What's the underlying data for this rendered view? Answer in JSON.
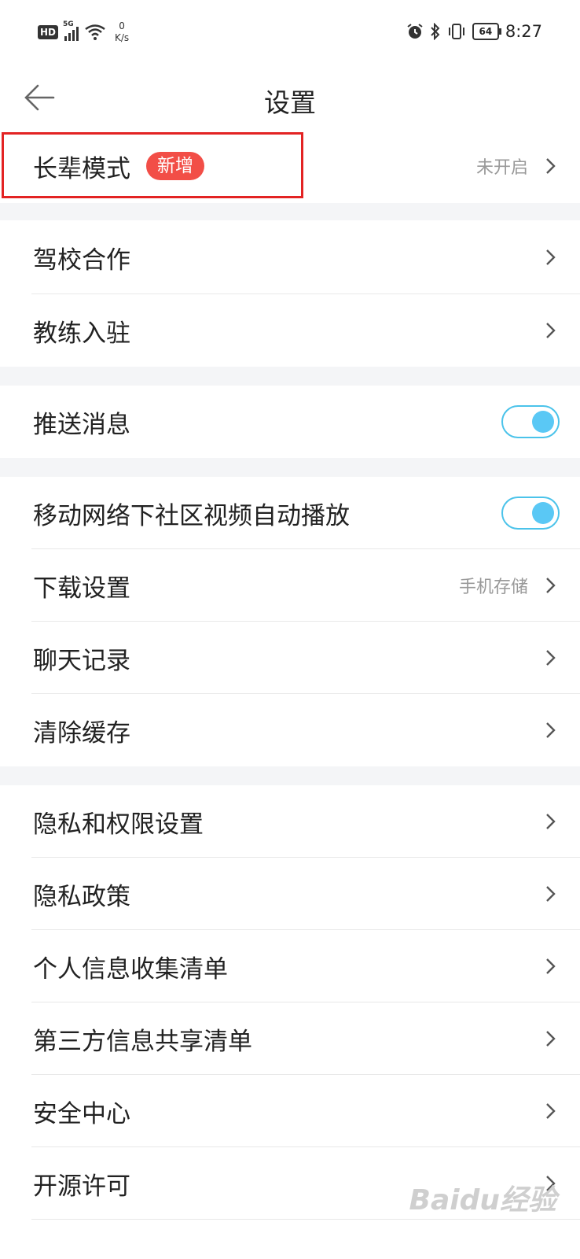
{
  "status_bar": {
    "hd": "HD",
    "network": "5G",
    "speed_value": "0",
    "speed_unit": "K/s",
    "battery": "64",
    "time": "8:27",
    "icons": [
      "hd-icon",
      "signal-icon",
      "wifi-icon",
      "alarm-icon",
      "bluetooth-icon",
      "vibrate-icon",
      "battery-icon"
    ]
  },
  "header": {
    "title": "设置",
    "back_icon": "back-arrow-icon"
  },
  "settings": {
    "elder_mode": {
      "label": "长辈模式",
      "badge": "新增",
      "value": "未开启"
    },
    "driving_school": {
      "label": "驾校合作"
    },
    "coach_join": {
      "label": "教练入驻"
    },
    "push_messages": {
      "label": "推送消息",
      "enabled": true
    },
    "autoplay_video": {
      "label": "移动网络下社区视频自动播放",
      "enabled": true
    },
    "download_settings": {
      "label": "下载设置",
      "value": "手机存储"
    },
    "chat_history": {
      "label": "聊天记录"
    },
    "clear_cache": {
      "label": "清除缓存"
    },
    "privacy_permissions": {
      "label": "隐私和权限设置"
    },
    "privacy_policy": {
      "label": "隐私政策"
    },
    "personal_info_list": {
      "label": "个人信息收集清单"
    },
    "third_party_list": {
      "label": "第三方信息共享清单"
    },
    "security_center": {
      "label": "安全中心"
    },
    "open_source": {
      "label": "开源许可"
    }
  },
  "colors": {
    "accent": "#4bc3ea",
    "badge": "#f24e47",
    "highlight_border": "#e32323",
    "section_gap": "#f4f5f7"
  },
  "watermark": "Baidu经验"
}
